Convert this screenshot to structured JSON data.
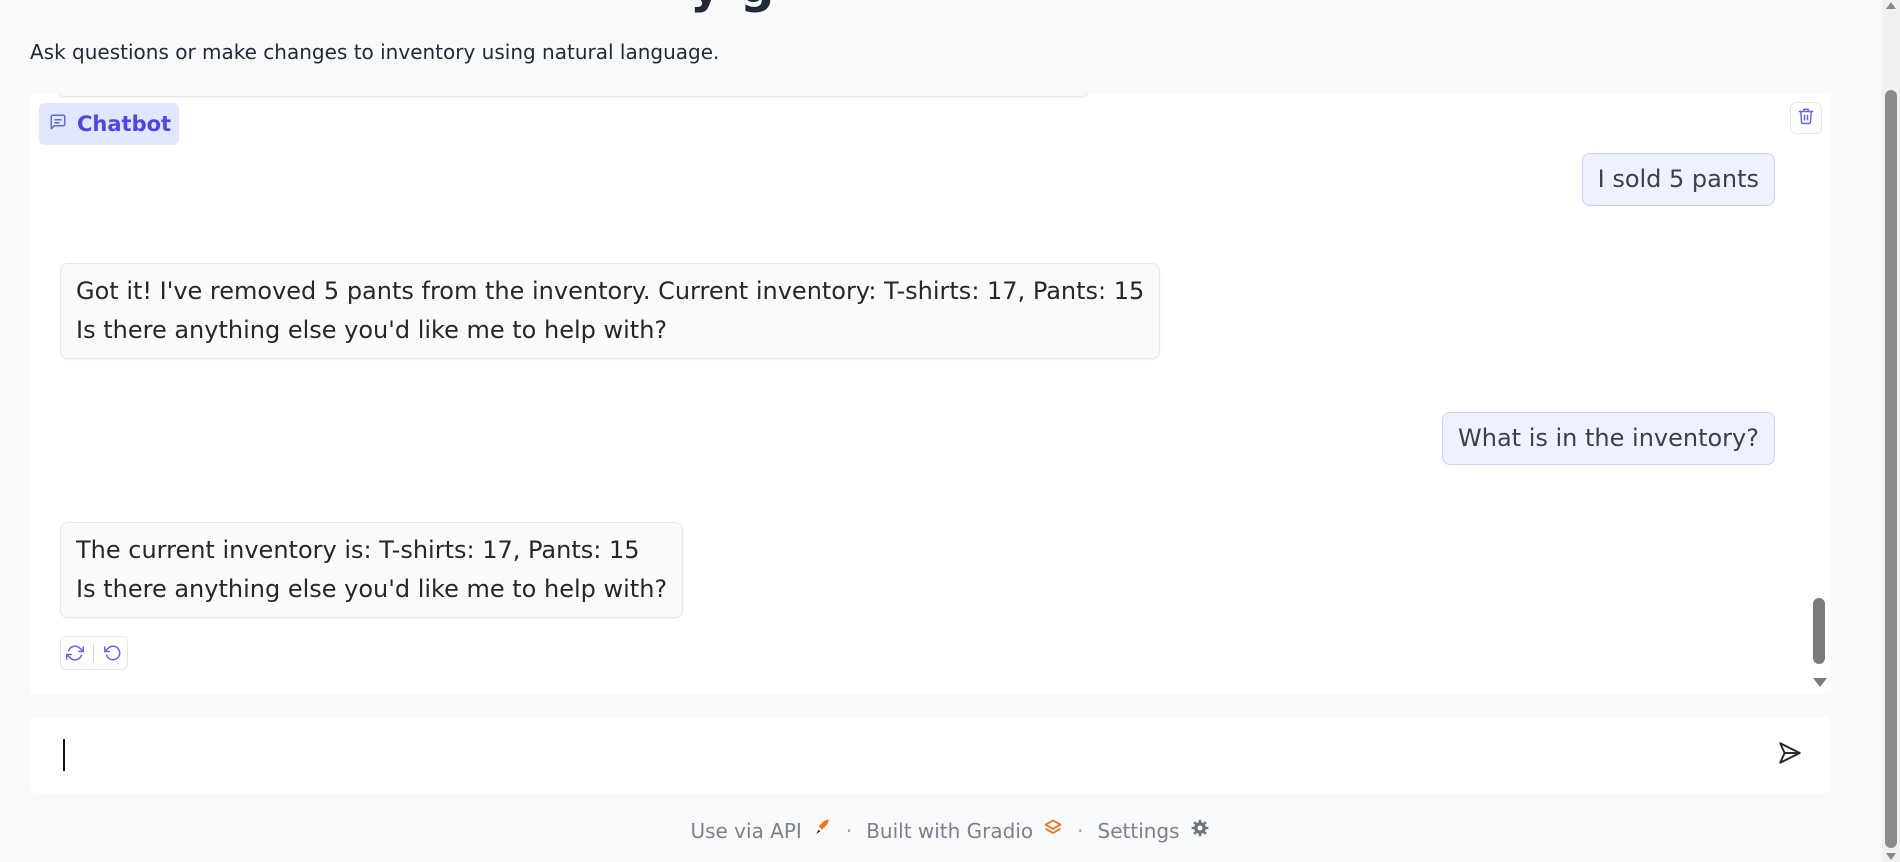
{
  "header": {
    "title_fragment": "y  g",
    "subtitle": "Ask questions or make changes to inventory using natural language."
  },
  "chatbot": {
    "label": "Chatbot",
    "messages": [
      {
        "role": "user",
        "lines": [
          "I sold 5 pants"
        ]
      },
      {
        "role": "bot",
        "lines": [
          "Got it! I've removed 5 pants from the inventory. Current inventory: T-shirts: 17, Pants: 15",
          "Is there anything else you'd like me to help with?"
        ]
      },
      {
        "role": "user",
        "lines": [
          "What is in the inventory?"
        ]
      },
      {
        "role": "bot",
        "lines": [
          "The current inventory is: T-shirts: 17, Pants: 15",
          "Is there anything else you'd like me to help with?"
        ]
      }
    ]
  },
  "input": {
    "value": "",
    "placeholder": ""
  },
  "footer": {
    "api": "Use via API",
    "built": "Built with Gradio",
    "settings": "Settings",
    "separator": "·"
  },
  "colors": {
    "accent": "#4f46e5",
    "user_bubble": "#eef2ff",
    "bot_bubble": "#f9fafb",
    "gradio_orange": "#f97316"
  }
}
